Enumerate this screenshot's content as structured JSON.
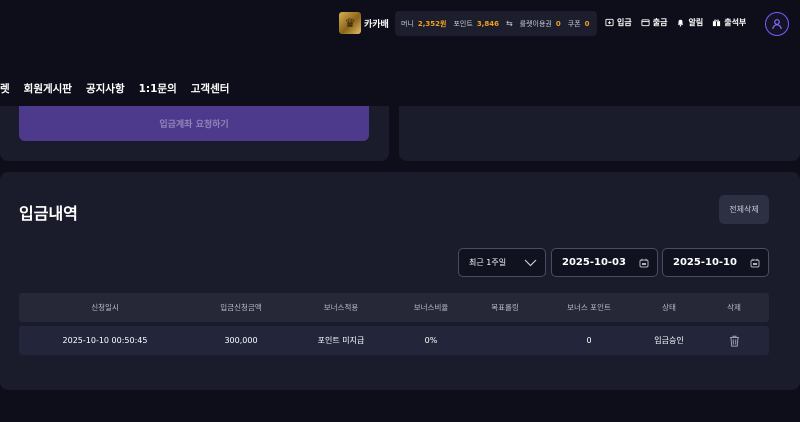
{
  "header": {
    "user_name": "카카배",
    "balance": [
      {
        "label": "머니",
        "value": "2,352원"
      },
      {
        "label": "포인트",
        "value": "3,846"
      },
      {
        "label": "룰렛이용권",
        "value": "0"
      },
      {
        "label": "쿠폰",
        "value": "0"
      }
    ],
    "actions": {
      "deposit": "입금",
      "withdraw": "출금",
      "notifications": "알림",
      "attendance": "출석부"
    }
  },
  "nav": {
    "items": [
      "렛",
      "회원게시판",
      "공지사항",
      "1:1문의",
      "고객센터"
    ]
  },
  "deposit_request": {
    "button_label": "입금계좌 요청하기"
  },
  "history": {
    "title": "입금내역",
    "delete_all_label": "전체삭제",
    "period": "최근 1주일",
    "date_start": "2025-10-03",
    "date_end": "2025-10-10",
    "columns": [
      "신청일시",
      "입금신청금액",
      "보너스적용",
      "보너스비율",
      "목표롤링",
      "보너스 포인트",
      "상태",
      "삭제"
    ],
    "rows": [
      {
        "requested_at": "2025-10-10 00:50:45",
        "amount": "300,000",
        "bonus_applied": "포인트 미지급",
        "bonus_rate": "0%",
        "target_rolling": "",
        "bonus_points": "0",
        "status": "입금승인"
      }
    ]
  },
  "colors": {
    "background": "#0d0e1a",
    "panel": "#1a1b2b",
    "accent_purple": "#4e3a8c",
    "money_orange": "#f0a020"
  }
}
